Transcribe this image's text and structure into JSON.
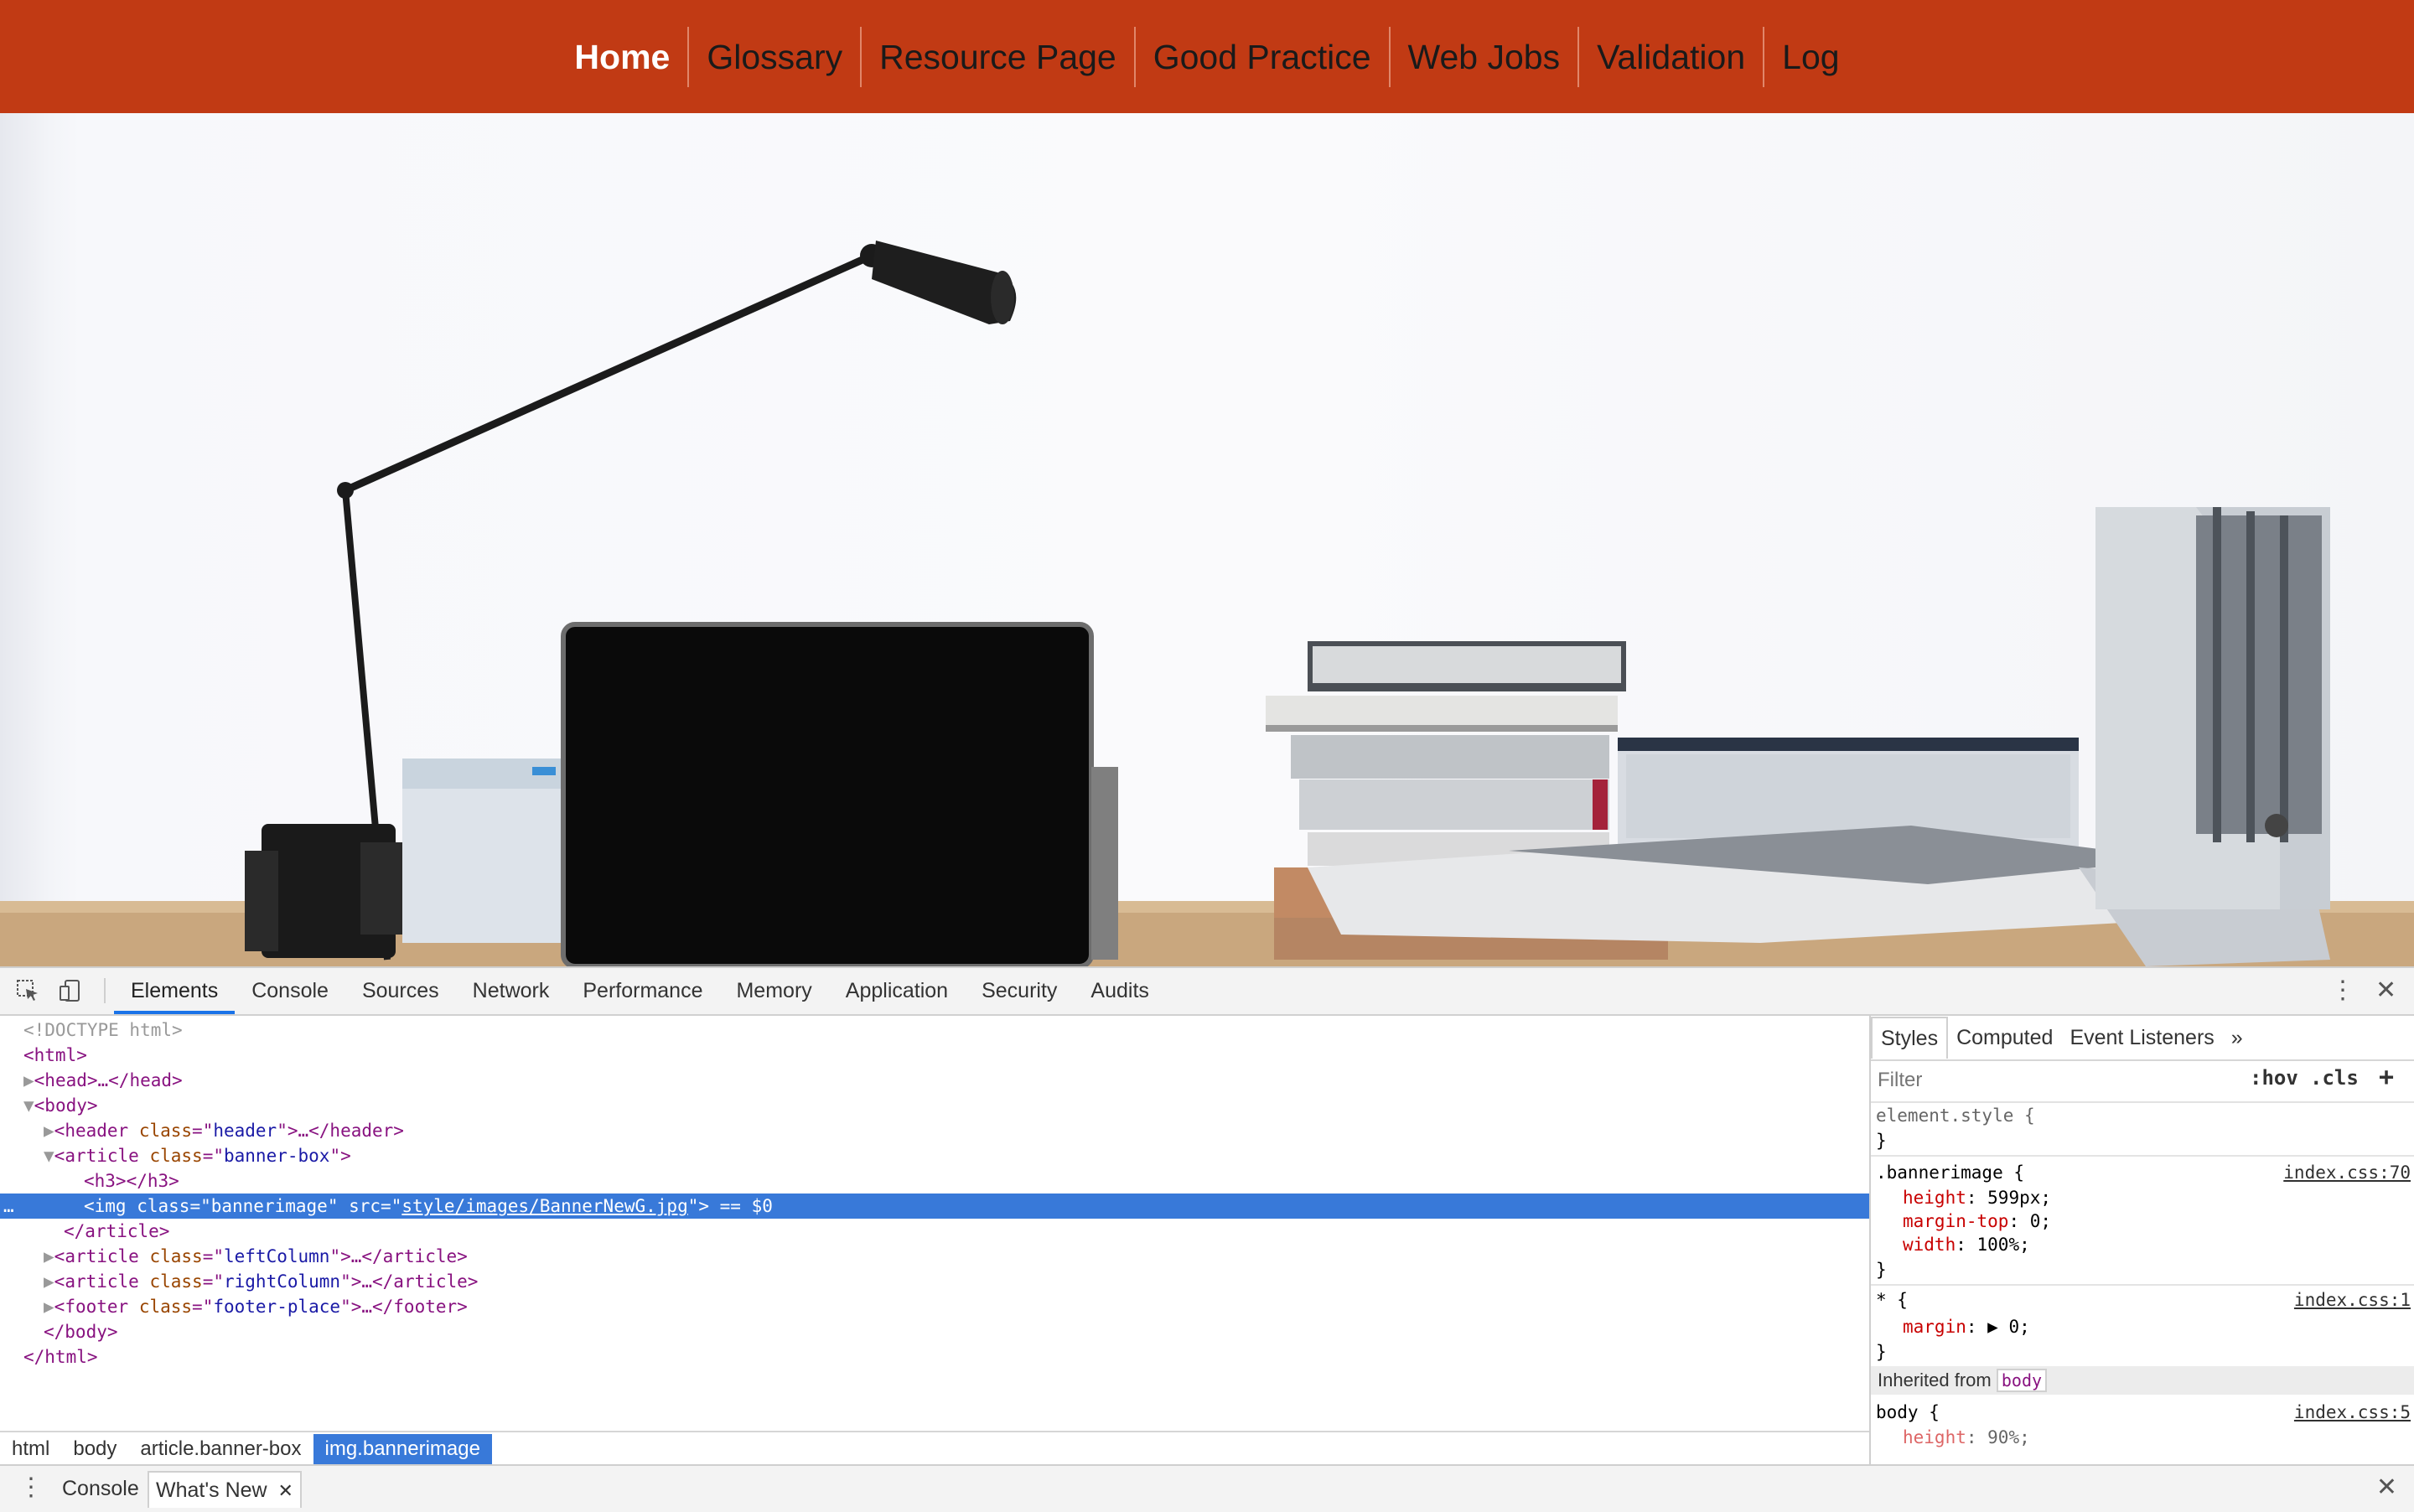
{
  "nav": {
    "items": [
      {
        "label": "Home"
      },
      {
        "label": "Glossary"
      },
      {
        "label": "Resource Page"
      },
      {
        "label": "Good Practice"
      },
      {
        "label": "Web Jobs"
      },
      {
        "label": "Validation"
      },
      {
        "label": "Log"
      }
    ]
  },
  "colors": {
    "nav_bg": "#c13a14",
    "selection": "#3879d9"
  },
  "devtools": {
    "toolbar_icons": [
      "inspect-element-icon",
      "device-toolbar-icon",
      "more-vertical-icon",
      "close-icon"
    ],
    "tabs": [
      {
        "label": "Elements",
        "active": true
      },
      {
        "label": "Console"
      },
      {
        "label": "Sources"
      },
      {
        "label": "Network"
      },
      {
        "label": "Performance"
      },
      {
        "label": "Memory"
      },
      {
        "label": "Application"
      },
      {
        "label": "Security"
      },
      {
        "label": "Audits"
      }
    ],
    "dom": {
      "doctype": "<!DOCTYPE html>",
      "html_open": "<html>",
      "head": "<head>…</head>",
      "body_open": "<body>",
      "header": {
        "tag": "header",
        "attr": "class",
        "value": "header",
        "tail": ">…</header>"
      },
      "article_banner": {
        "tag": "article",
        "attr": "class",
        "value": "banner-box"
      },
      "h3": "<h3></h3>",
      "img": {
        "class": "bannerimage",
        "src": "style/images/BannerNewG.jpg",
        "suffix": "== $0"
      },
      "article_close": "</article>",
      "left": {
        "tag": "article",
        "attr": "class",
        "value": "leftColumn",
        "tail": ">…</article>"
      },
      "right": {
        "tag": "article",
        "attr": "class",
        "value": "rightColumn",
        "tail": ">…</article>"
      },
      "footer": {
        "tag": "footer",
        "attr": "class",
        "value": "footer-place",
        "tail": ">…</footer>"
      },
      "body_close": "</body>",
      "html_close": "</html>"
    },
    "breadcrumb": [
      "html",
      "body",
      "article.banner-box",
      "img.bannerimage"
    ],
    "styles": {
      "tabs": [
        "Styles",
        "Computed",
        "Event Listeners",
        "»"
      ],
      "filter_placeholder": "Filter",
      "hov": ":hov",
      "cls": ".cls",
      "add": "+",
      "element_style": "element.style {",
      "rule1": {
        "selector": ".bannerimage {",
        "source": "index.css:70",
        "props": [
          {
            "name": "height",
            "value": "599px;"
          },
          {
            "name": "margin-top",
            "value": "0;"
          },
          {
            "name": "width",
            "value": "100%;"
          }
        ]
      },
      "rule2": {
        "selector": "* {",
        "source": "index.css:1",
        "props": [
          {
            "name": "margin",
            "value": "▶ 0;"
          }
        ]
      },
      "inherited_label": "Inherited from",
      "inherited_from": "body",
      "rule3": {
        "selector": "body {",
        "source": "index.css:5",
        "props": [
          {
            "name": "height",
            "value": "90%;"
          }
        ]
      },
      "close_brace": "}"
    },
    "drawer": {
      "tabs": [
        {
          "label": "Console"
        },
        {
          "label": "What's New",
          "closable": true
        }
      ]
    }
  }
}
